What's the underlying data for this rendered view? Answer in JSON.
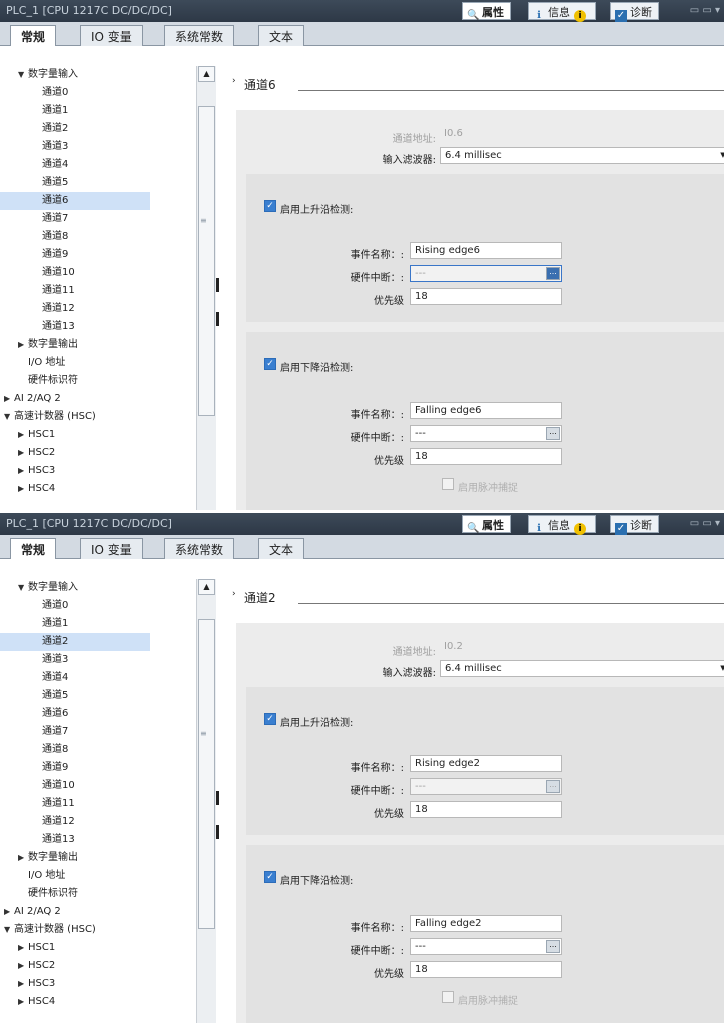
{
  "panels": [
    {
      "title": "PLC_1 [CPU 1217C DC/DC/DC]",
      "toolbar": {
        "properties": "属性",
        "info": "信息",
        "diagnostics": "诊断"
      },
      "tabs": [
        "常规",
        "IO 变量",
        "系统常数",
        "文本"
      ],
      "tree": [
        {
          "label": "数字量输入",
          "arrow": "▼",
          "indent": 1
        },
        {
          "label": "通道0",
          "indent": 2
        },
        {
          "label": "通道1",
          "indent": 2
        },
        {
          "label": "通道2",
          "indent": 2
        },
        {
          "label": "通道3",
          "indent": 2
        },
        {
          "label": "通道4",
          "indent": 2
        },
        {
          "label": "通道5",
          "indent": 2
        },
        {
          "label": "通道6",
          "indent": 2,
          "selected": true
        },
        {
          "label": "通道7",
          "indent": 2
        },
        {
          "label": "通道8",
          "indent": 2
        },
        {
          "label": "通道9",
          "indent": 2
        },
        {
          "label": "通道10",
          "indent": 2
        },
        {
          "label": "通道11",
          "indent": 2
        },
        {
          "label": "通道12",
          "indent": 2
        },
        {
          "label": "通道13",
          "indent": 2
        },
        {
          "label": "数字量输出",
          "arrow": "▶",
          "indent": 1
        },
        {
          "label": "I/O 地址",
          "indent": 1
        },
        {
          "label": "硬件标识符",
          "indent": 1
        },
        {
          "label": "AI 2/AQ 2",
          "arrow": "▶",
          "indent": 0
        },
        {
          "label": "高速计数器 (HSC)",
          "arrow": "▼",
          "indent": 0
        },
        {
          "label": "HSC1",
          "arrow": "▶",
          "indent": 1
        },
        {
          "label": "HSC2",
          "arrow": "▶",
          "indent": 1
        },
        {
          "label": "HSC3",
          "arrow": "▶",
          "indent": 1
        },
        {
          "label": "HSC4",
          "arrow": "▶",
          "indent": 1
        }
      ],
      "section_title": "通道6",
      "channel_address_label": "通道地址:",
      "channel_address": "I0.6",
      "input_filter_label": "输入滤波器:",
      "input_filter": "6.4 millisec",
      "rising": {
        "checkbox_label": "启用上升沿检测:",
        "event_name_label": "事件名称：:",
        "event_name": "Rising edge6",
        "hw_interrupt_label": "硬件中断：:",
        "hw_interrupt": "---",
        "priority_label": "优先级",
        "priority": "18"
      },
      "falling": {
        "checkbox_label": "启用下降沿检测:",
        "event_name_label": "事件名称：:",
        "event_name": "Falling edge6",
        "hw_interrupt_label": "硬件中断：:",
        "hw_interrupt": "---",
        "priority_label": "优先级",
        "priority": "18"
      },
      "pulse_catch_label": "启用脉冲捕捉"
    },
    {
      "title": "PLC_1 [CPU 1217C DC/DC/DC]",
      "toolbar": {
        "properties": "属性",
        "info": "信息",
        "diagnostics": "诊断"
      },
      "tabs": [
        "常规",
        "IO 变量",
        "系统常数",
        "文本"
      ],
      "tree": [
        {
          "label": "数字量输入",
          "arrow": "▼",
          "indent": 1
        },
        {
          "label": "通道0",
          "indent": 2
        },
        {
          "label": "通道1",
          "indent": 2
        },
        {
          "label": "通道2",
          "indent": 2,
          "selected": true
        },
        {
          "label": "通道3",
          "indent": 2
        },
        {
          "label": "通道4",
          "indent": 2
        },
        {
          "label": "通道5",
          "indent": 2
        },
        {
          "label": "通道6",
          "indent": 2
        },
        {
          "label": "通道7",
          "indent": 2
        },
        {
          "label": "通道8",
          "indent": 2
        },
        {
          "label": "通道9",
          "indent": 2
        },
        {
          "label": "通道10",
          "indent": 2
        },
        {
          "label": "通道11",
          "indent": 2
        },
        {
          "label": "通道12",
          "indent": 2
        },
        {
          "label": "通道13",
          "indent": 2
        },
        {
          "label": "数字量输出",
          "arrow": "▶",
          "indent": 1
        },
        {
          "label": "I/O 地址",
          "indent": 1
        },
        {
          "label": "硬件标识符",
          "indent": 1
        },
        {
          "label": "AI 2/AQ 2",
          "arrow": "▶",
          "indent": 0
        },
        {
          "label": "高速计数器 (HSC)",
          "arrow": "▼",
          "indent": 0
        },
        {
          "label": "HSC1",
          "arrow": "▶",
          "indent": 1
        },
        {
          "label": "HSC2",
          "arrow": "▶",
          "indent": 1
        },
        {
          "label": "HSC3",
          "arrow": "▶",
          "indent": 1
        },
        {
          "label": "HSC4",
          "arrow": "▶",
          "indent": 1
        }
      ],
      "section_title": "通道2",
      "channel_address_label": "通道地址:",
      "channel_address": "I0.2",
      "input_filter_label": "输入滤波器:",
      "input_filter": "6.4 millisec",
      "rising": {
        "checkbox_label": "启用上升沿检测:",
        "event_name_label": "事件名称：:",
        "event_name": "Rising edge2",
        "hw_interrupt_label": "硬件中断：:",
        "hw_interrupt": "---",
        "priority_label": "优先级",
        "priority": "18"
      },
      "falling": {
        "checkbox_label": "启用下降沿检测:",
        "event_name_label": "事件名称：:",
        "event_name": "Falling edge2",
        "hw_interrupt_label": "硬件中断：:",
        "hw_interrupt": "---",
        "priority_label": "优先级",
        "priority": "18"
      },
      "pulse_catch_label": "启用脉冲捕捉"
    }
  ]
}
